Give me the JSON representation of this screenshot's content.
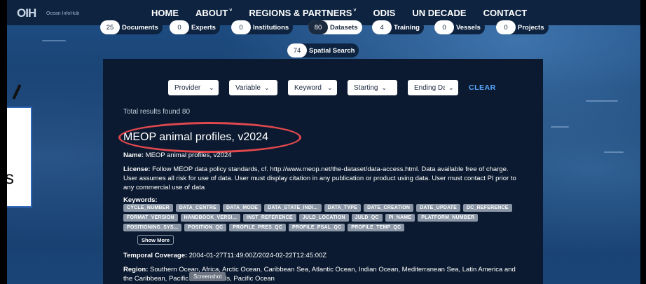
{
  "nav": {
    "logo_letters": "OIH",
    "logo_text": "Ocean InfoHub",
    "links": [
      {
        "label": "HOME",
        "has_caret": false
      },
      {
        "label": "ABOUT",
        "has_caret": true
      },
      {
        "label": "REGIONS & PARTNERS",
        "has_caret": true
      },
      {
        "label": "ODIS",
        "has_caret": false
      },
      {
        "label": "UN DECADE",
        "has_caret": false
      },
      {
        "label": "CONTACT",
        "has_caret": false
      }
    ],
    "caret_glyph": "˅"
  },
  "counts": [
    {
      "count": "25",
      "label": "Documents"
    },
    {
      "count": "0",
      "label": "Experts"
    },
    {
      "count": "0",
      "label": "Institutions"
    },
    {
      "count": "80",
      "label": "Datasets",
      "active": true
    },
    {
      "count": "4",
      "label": "Training"
    },
    {
      "count": "0",
      "label": "Vessels"
    },
    {
      "count": "0",
      "label": "Projects"
    }
  ],
  "spatial": {
    "count": "74",
    "label": "Spatial Search"
  },
  "left_fragment": {
    "text": "ss"
  },
  "filters": [
    {
      "label": "Provider"
    },
    {
      "label": "Variable"
    },
    {
      "label": "Keyword"
    },
    {
      "label": "Starting"
    },
    {
      "label": "Ending Date"
    }
  ],
  "chevron_glyph": "⌄",
  "clear_label": "CLEAR",
  "total_text": "Total results found 80",
  "result": {
    "title": "MEOP animal profiles, v2024",
    "name_label": "Name:",
    "name_value": " MEOP animal profiles, v2024",
    "license_label": "License:",
    "license_value": " Follow MEOP data policy standards, cf. http://www.meop.net/the-dataset/data-access.html. Data available free of charge. User assumes all risk for use of data. User must display citation in any publication or product using data. User must contact PI prior to any commercial use of data",
    "keywords_label": "Keywords:",
    "keywords": [
      "CYCLE_NUMBER",
      "DATA_CENTRE",
      "DATA_MODE",
      "DATA_STATE_INDI...",
      "DATA_TYPE",
      "DATE_CREATION",
      "DATE_UPDATE",
      "DC_REFERENCE",
      "FORMAT_VERSION",
      "HANDBOOK_VERSI...",
      "INST_REFERENCE",
      "JULD_LOCATION",
      "JULD_QC",
      "PI_NAME",
      "PLATFORM_NUMBER",
      "POSITIONING_SYS...",
      "POSITION_QC",
      "PROFILE_PRES_QC",
      "PROFILE_PSAL_QC",
      "PROFILE_TEMP_QC"
    ],
    "show_more_label": "Show More",
    "temporal_label": "Temporal Coverage:",
    "temporal_value": " 2004-01-27T11:49:00Z/2024-02-22T12:45:00Z",
    "region_label": "Region:",
    "region_value": " Southern Ocean, Africa, Arctic Ocean, Caribbean Sea, Atlantic Ocean, Indian Ocean, Mediterranean Sea, Latin America and the Caribbean, Pacific Small Islands, Pacific Ocean"
  },
  "tooltip": "Screenshot",
  "colors": {
    "nav_bg": "#0d2340",
    "panel_bg": "#0b1a30",
    "accent_link": "#5aa9ff",
    "highlight_ellipse": "#e0484e",
    "tag_bg": "#8a96a6"
  }
}
